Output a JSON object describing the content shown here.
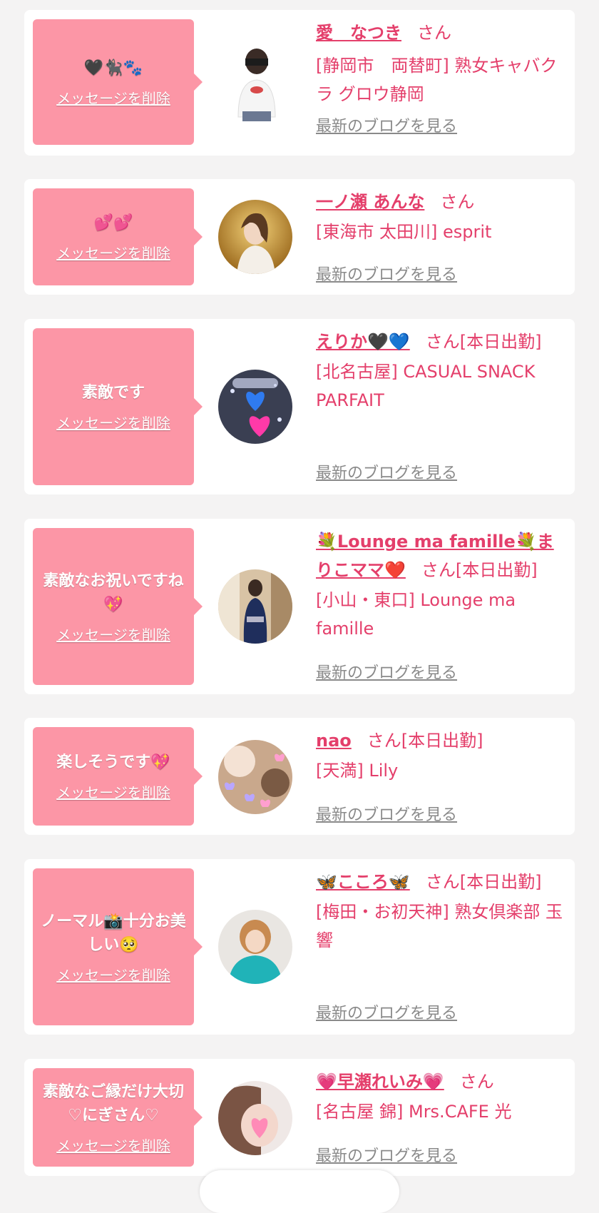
{
  "cards": [
    {
      "message": "🖤🐈‍⬛🐾",
      "delete_label": "メッセージを削除",
      "name": "愛　なつき",
      "san": "さん",
      "extra": "",
      "shop": "[静岡市　両替町] 熟女キャバクラ グロウ静岡",
      "blog": "最新のブログを見る"
    },
    {
      "message": "💕💕",
      "delete_label": "メッセージを削除",
      "name": "一ノ瀬 あんな",
      "san": "さん",
      "extra": "",
      "shop": "[東海市 太田川] esprit",
      "blog": "最新のブログを見る"
    },
    {
      "message": "素敵です",
      "delete_label": "メッセージを削除",
      "name": "えりか🖤💙",
      "san": "さん",
      "extra": "[本日出勤]",
      "shop": "[北名古屋] CASUAL SNACK PARFAIT",
      "blog": "最新のブログを見る"
    },
    {
      "message": "素敵なお祝いですね💖",
      "delete_label": "メッセージを削除",
      "name": "💐Lounge ma famille💐まりこママ❤️",
      "san": "さん",
      "extra": "[本日出勤]",
      "shop": "[小山・東口] Lounge ma famille",
      "blog": "最新のブログを見る"
    },
    {
      "message": "楽しそうです💖",
      "delete_label": "メッセージを削除",
      "name": "nao",
      "san": "さん",
      "extra": "[本日出勤]",
      "shop": "[天満] Lily",
      "blog": "最新のブログを見る"
    },
    {
      "message": "ノーマル📸十分お美しい🥺",
      "delete_label": "メッセージを削除",
      "name": "🦋こころ🦋",
      "san": "さん",
      "extra": "[本日出勤]",
      "shop": "[梅田・お初天神] 熟女倶楽部 玉響",
      "blog": "最新のブログを見る"
    },
    {
      "message": "素敵なご縁だけ大切♡にぎさん♡",
      "delete_label": "メッセージを削除",
      "name": "💗早瀬れいみ💗",
      "san": "さん",
      "extra": "",
      "shop": "[名古屋 錦] Mrs.CAFE 光",
      "blog": "最新のブログを見る"
    }
  ],
  "colors": {
    "accent": "#e43f6b",
    "bubble": "#fc96a6",
    "background": "#f4f3f3",
    "link_gray": "#8a8a8a"
  }
}
